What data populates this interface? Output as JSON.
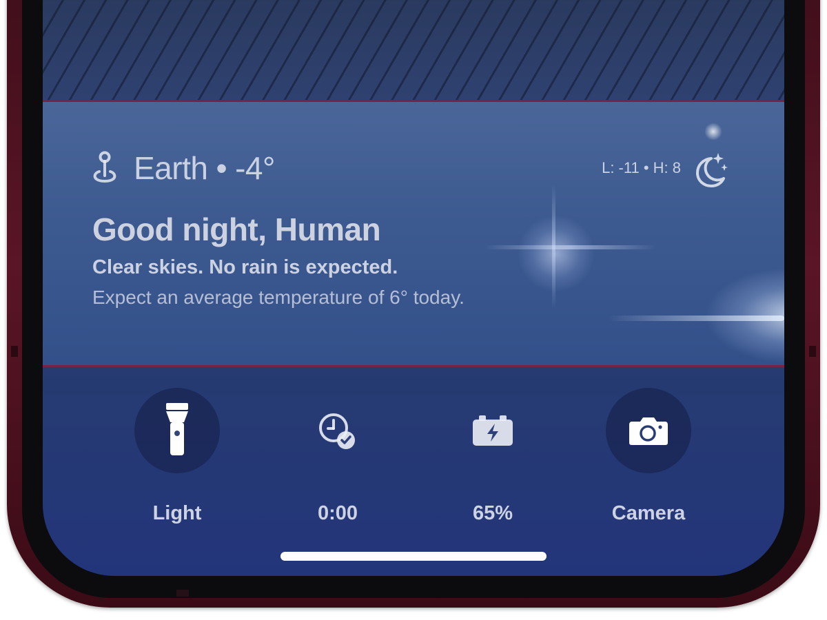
{
  "weather": {
    "location": "Earth",
    "separator": "•",
    "temperature": "-4°",
    "low_high": "L: -11 • H: 8",
    "greeting": "Good night, Human",
    "conditions": "Clear skies. No rain is expected.",
    "forecast": "Expect an average temperature of 6° today.",
    "icons": {
      "location": "location-pin-icon",
      "condition": "moon-stars-icon"
    }
  },
  "actions": [
    {
      "label": "Light",
      "icon": "flashlight-icon"
    },
    {
      "label": "0:00",
      "icon": "clock-check-icon"
    },
    {
      "label": "65%",
      "icon": "battery-charging-icon"
    },
    {
      "label": "Camera",
      "icon": "camera-icon"
    }
  ],
  "colors": {
    "frame": "#5a1526",
    "screen": "#2a3d6a",
    "widget": "#3d5a90",
    "divider": "#7a2340",
    "text": "#ebeef5"
  }
}
